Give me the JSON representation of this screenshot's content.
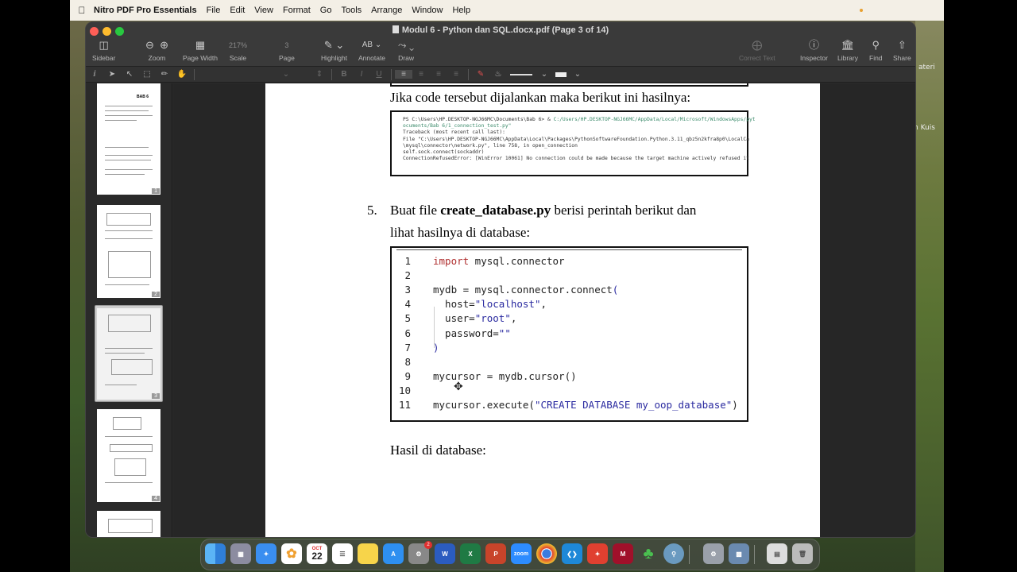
{
  "menubar": {
    "app_name": "Nitro PDF Pro Essentials",
    "items": [
      "File",
      "Edit",
      "View",
      "Format",
      "Go",
      "Tools",
      "Arrange",
      "Window",
      "Help"
    ]
  },
  "window": {
    "title": "Modul 6 - Python dan SQL.docx.pdf (Page 3 of 14)"
  },
  "toolbar": {
    "sidebar": "Sidebar",
    "zoom": "Zoom",
    "page_width": "Page Width",
    "scale": "Scale",
    "scale_value": "217%",
    "page": "Page",
    "page_value": "3",
    "highlight": "Highlight",
    "annotate": "Annotate",
    "annotate_icon_text": "AB",
    "draw": "Draw",
    "correct_text": "Correct Text",
    "inspector": "Inspector",
    "library": "Library",
    "find": "Find",
    "share": "Share"
  },
  "formatbar": {
    "bold": "B",
    "italic": "I",
    "underline": "U"
  },
  "sidebar": {
    "thumb_numbers": [
      "1",
      "2",
      "3",
      "4"
    ],
    "thumb1_heading": "BAB 6",
    "selected_page": "3"
  },
  "desktop": {
    "label_top": "ateri",
    "label_mid": "n Kuis"
  },
  "document": {
    "intro_text": "Jika code tersebut dijalankan maka berikut ini hasilnya:",
    "terminal_lines": [
      {
        "text": "PS C:\\Users\\HP.DESKTOP-NGJ66MC\\Documents\\Bab 6> & ",
        "green": "C:/Users/HP.DESKTOP-NGJ66MC/AppData/Local/Microsoft/WindowsApps/pyt"
      },
      {
        "text": "",
        "green": "ocuments/Bab 6/1_connection_test.py\""
      },
      {
        "text": "Traceback (most recent call last):",
        "green": ""
      },
      {
        "text": "  File \"C:\\Users\\HP.DESKTOP-NGJ66MC\\AppData\\Local\\Packages\\PythonSoftwareFoundation.Python.3.11_qbz5n2kfra8p0\\LocalCa",
        "green": ""
      },
      {
        "text": "\\mysql\\connector\\network.py\", line 758, in open_connection",
        "green": ""
      },
      {
        "text": "    self.sock.connect(sockaddr)",
        "green": ""
      },
      {
        "text": "ConnectionRefusedError: [WinError 10061] No connection could be made because the target machine actively refused it",
        "green": ""
      }
    ],
    "step_number": "5.",
    "step_text_pre": "Buat file ",
    "step_filename": "create_database.py",
    "step_text_post": " berisi perintah berikut dan",
    "step_text_line2": "lihat hasilnya di database:",
    "code_lines": [
      {
        "no": "1",
        "parts": [
          [
            "kw",
            "import"
          ],
          [
            "",
            " mysql.connector"
          ]
        ]
      },
      {
        "no": "2",
        "parts": []
      },
      {
        "no": "3",
        "parts": [
          [
            "",
            "mydb = mysql.connector.connect"
          ],
          [
            "str",
            "("
          ]
        ]
      },
      {
        "no": "4",
        "parts": [
          [
            "",
            "  host="
          ],
          [
            "str",
            "\"localhost\""
          ],
          [
            "",
            ","
          ]
        ]
      },
      {
        "no": "5",
        "parts": [
          [
            "",
            "  user="
          ],
          [
            "str",
            "\"root\""
          ],
          [
            "",
            ","
          ]
        ]
      },
      {
        "no": "6",
        "parts": [
          [
            "",
            "  password="
          ],
          [
            "str",
            "\"\""
          ]
        ]
      },
      {
        "no": "7",
        "parts": [
          [
            "str",
            ")"
          ]
        ]
      },
      {
        "no": "8",
        "parts": []
      },
      {
        "no": "9",
        "parts": [
          [
            "",
            "mycursor = mydb.cursor()"
          ]
        ]
      },
      {
        "no": "10",
        "parts": []
      },
      {
        "no": "11",
        "parts": [
          [
            "",
            "mycursor.execute("
          ],
          [
            "str",
            "\"CREATE DATABASE my_oop_database\""
          ],
          [
            "",
            ")"
          ]
        ]
      }
    ],
    "result_text": "Hasil di database:"
  },
  "dock": {
    "calendar_month": "OCT",
    "calendar_day": "22",
    "settings_badge": "2",
    "zoom_label": "zoom",
    "apps": [
      "finder",
      "launchpad",
      "safari",
      "photos",
      "calendar",
      "reminders",
      "notes",
      "app-store",
      "system-settings",
      "word",
      "excel",
      "powerpoint",
      "zoom",
      "chrome",
      "vscode",
      "nitro-pdf",
      "mendeley",
      "solitaire",
      "network-utility",
      "disk-utility",
      "preview",
      "files",
      "trash"
    ]
  }
}
